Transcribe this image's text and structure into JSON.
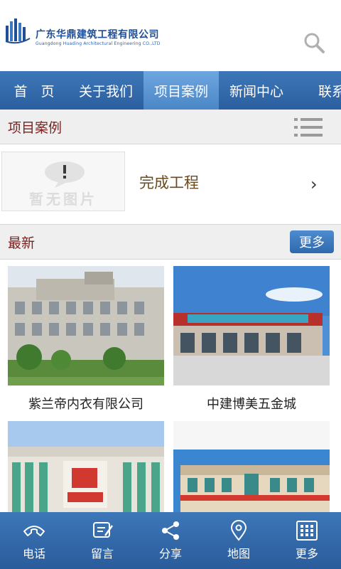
{
  "header": {
    "company_name": "广东华鼎建筑工程有限公司",
    "company_name_en": "Guangdong Huading Architectural Engineering CO.,LTD",
    "search_icon": "search-icon"
  },
  "nav": {
    "items": [
      {
        "label": "首　页"
      },
      {
        "label": "关于我们"
      },
      {
        "label": "项目案例"
      },
      {
        "label": "新闻中心"
      },
      {
        "label": "联系"
      }
    ],
    "active_index": 2
  },
  "section": {
    "title": "项目案例",
    "menu_icon": "list-icon"
  },
  "category": {
    "placeholder_text": "暂无图片",
    "label": "完成工程",
    "chevron": "›"
  },
  "latest": {
    "title": "最新",
    "more_label": "更多",
    "projects": [
      {
        "name": "紫兰帝内衣有限公司"
      },
      {
        "name": "中建博美五金城"
      },
      {
        "name": ""
      },
      {
        "name": ""
      }
    ]
  },
  "bottom_bar": {
    "items": [
      {
        "label": "电话",
        "icon": "phone-icon"
      },
      {
        "label": "留言",
        "icon": "message-icon"
      },
      {
        "label": "分享",
        "icon": "share-icon"
      },
      {
        "label": "地图",
        "icon": "map-pin-icon"
      },
      {
        "label": "更多",
        "icon": "grid-icon"
      }
    ]
  },
  "colors": {
    "brand_blue": "#2b5f9f",
    "nav_active": "#5f99d6",
    "section_title": "#7b2222"
  }
}
